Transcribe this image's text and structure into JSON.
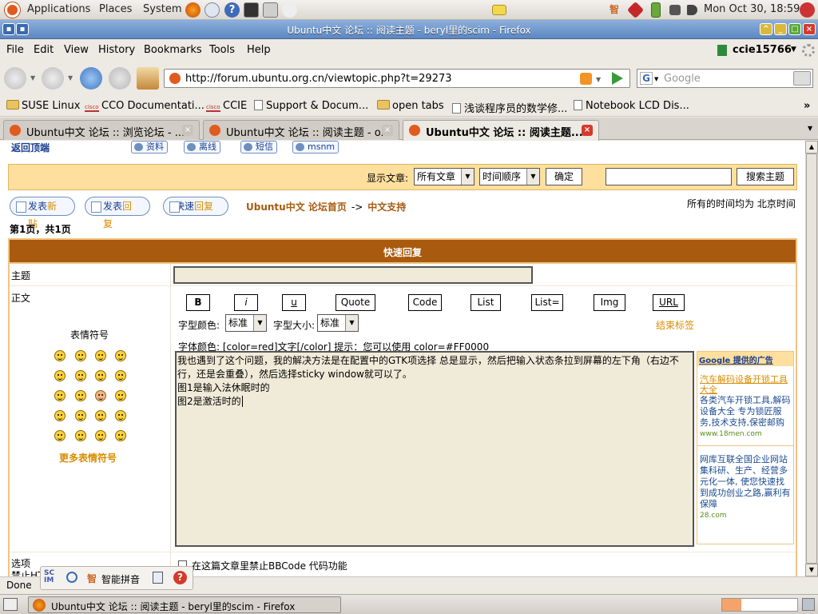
{
  "panel": {
    "menus": [
      "Applications",
      "Places",
      "System"
    ],
    "clock": "Mon Oct 30, 18:59"
  },
  "window": {
    "title": "Ubuntu中文 论坛 :: 阅读主题 - beryl里的scim - Firefox"
  },
  "menubar": {
    "file": "File",
    "edit": "Edit",
    "view": "View",
    "history": "History",
    "bookmarks": "Bookmarks",
    "tools": "Tools",
    "help": "Help",
    "user": "ccie15766"
  },
  "nav": {
    "url": "http://forum.ubuntu.org.cn/viewtopic.php?t=29273",
    "search_placeholder": "Google"
  },
  "bookmarks": [
    {
      "label": "SUSE Linux",
      "icon": "folder-icon"
    },
    {
      "label": "CCO Documentati...",
      "icon": "cisco-icon"
    },
    {
      "label": "CCIE",
      "icon": "cisco-icon"
    },
    {
      "label": "Support & Docum...",
      "icon": "page-icon"
    },
    {
      "label": "open tabs",
      "icon": "folder-icon"
    },
    {
      "label": "浅谈程序员的数学修...",
      "icon": "page-icon"
    },
    {
      "label": "Notebook LCD Dis...",
      "icon": "page-icon"
    }
  ],
  "tabs": [
    {
      "label": "Ubuntu中文 论坛 :: 浏览论坛 - ..."
    },
    {
      "label": "Ubuntu中文 论坛 :: 阅读主题 - o..."
    },
    {
      "label": "Ubuntu中文 论坛 :: 阅读主题..."
    }
  ],
  "page": {
    "back_to_top": "返回顶端",
    "profile_buttons": [
      "资料",
      "离线",
      "短信",
      "msnm"
    ],
    "filter": {
      "show_label": "显示文章:",
      "show_value": "所有文章",
      "order_value": "时间顺序",
      "ok": "确定",
      "search_btn": "搜索主题"
    },
    "buttons": {
      "new_post_a": "发表",
      "new_post_b": "新贴",
      "reply_a": "发表",
      "reply_b": "回复",
      "quick_a": "快速",
      "quick_b": "回复"
    },
    "breadcrumb_home": "Ubuntu中文 论坛首页",
    "breadcrumb_sep": "->",
    "breadcrumb_section": "中文支持",
    "timezone": "所有的时间均为 北京时间",
    "pagecount": "第1页，共1页",
    "quick_reply": "快速回复",
    "subject_label": "主题",
    "body_label": "正文",
    "smilies_title": "表情符号",
    "more_smilies": "更多表情符号",
    "bbcode": [
      "B",
      "i",
      "u",
      "Quote",
      "Code",
      "List",
      "List=",
      "Img",
      "URL"
    ],
    "font_color_label": "字型颜色:",
    "font_color_value": "标准",
    "font_size_label": "字型大小:",
    "font_size_value": "标准",
    "close_tags": "结束标签",
    "hint": "字体颜色: [color=red]文字[/color]  提示：您可以使用 color=#FF0000",
    "message_lines": [
      "我也遇到了这个问题，我的解决方法是在配置中的GTK项选择 总是显示，然后把输入状态条拉到屏幕的左下角（右边不",
      "行，还是会重叠），然后选择sticky window就可以了。",
      "图1是输入法休眠时的",
      "图2是激活时的"
    ],
    "ads": {
      "header": "Google 提供的广告",
      "items": [
        {
          "title": "汽车解码设备开锁工具大全",
          "body": "各类汽车开锁工具,解码设备大全 专为锁匠服务,技术支持,保密邮购",
          "url": "www.18men.com"
        },
        {
          "title": "",
          "body": "网库互联全国企业网站集科研、生产、经营多元化一体, 使您快速找到成功创业之路,赢利有保障",
          "url": "28.com"
        }
      ]
    },
    "options_label": "选项",
    "options_partial": "禁止HT",
    "disable_bbcode": "在这篇文章里禁止BBCode 代码功能"
  },
  "status": {
    "text": "Done"
  },
  "scim": {
    "label": "智能拼音"
  },
  "taskbar": {
    "window": "Ubuntu中文 论坛 :: 阅读主题 - beryl里的scim - Firefox"
  },
  "colors": {
    "header_brown": "#a85a0e",
    "filter_bg": "#fedf9d",
    "accent_orange": "#d98c00",
    "link_blue": "#1a3d8f",
    "textarea_bg": "#f0ead9"
  }
}
